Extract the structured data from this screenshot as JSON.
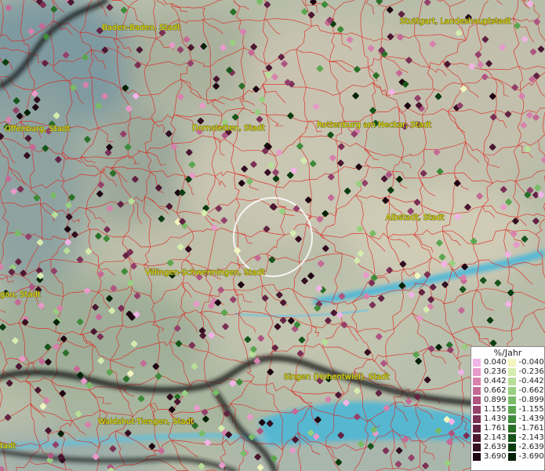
{
  "cities": [
    {
      "name": "Baden-Baden, Stadt"
    },
    {
      "name": "Stuttgart, Landeshauptstadt"
    },
    {
      "name": "Offenburg, Stadt"
    },
    {
      "name": "Dornstetten, Stadt"
    },
    {
      "name": "Rottenburg am Neckar, Stadt"
    },
    {
      "name": "Albstadt, Stadt"
    },
    {
      "name": "Villingen-Schwenningen, Stadt"
    },
    {
      "name": "Singen (Hohentwiel), Stadt"
    },
    {
      "name": "Waldshut-Tiengen, Stadt"
    },
    {
      "name": "gau, Stadt"
    },
    {
      "name": "tadt"
    }
  ],
  "legend": {
    "title": "%/Jahr",
    "positive": [
      {
        "label": "0.040",
        "color": "#f2b3e6"
      },
      {
        "label": "0.236",
        "color": "#e79ac9"
      },
      {
        "label": "0.442",
        "color": "#d781ad"
      },
      {
        "label": "0.662",
        "color": "#c46a95"
      },
      {
        "label": "0.899",
        "color": "#ae5580"
      },
      {
        "label": "1.155",
        "color": "#94416b"
      },
      {
        "label": "1.439",
        "color": "#7b3055"
      },
      {
        "label": "1.761",
        "color": "#632343"
      },
      {
        "label": "2.143",
        "color": "#4b1731"
      },
      {
        "label": "2.639",
        "color": "#340e21"
      },
      {
        "label": "3.690",
        "color": "#1e0512"
      }
    ],
    "negative": [
      {
        "label": "-0.040",
        "color": "#f2f5bd"
      },
      {
        "label": "-0.236",
        "color": "#d5ecae"
      },
      {
        "label": "-0.442",
        "color": "#b8df98"
      },
      {
        "label": "-0.662",
        "color": "#98cf80"
      },
      {
        "label": "-0.899",
        "color": "#79bb66"
      },
      {
        "label": "-1.155",
        "color": "#5ba54e"
      },
      {
        "label": "-1.439",
        "color": "#3e8b3a"
      },
      {
        "label": "-1.761",
        "color": "#2a7029"
      },
      {
        "label": "-2.143",
        "color": "#17551b"
      },
      {
        "label": "-2.639",
        "color": "#0b3c10"
      },
      {
        "label": "-3.690",
        "color": "#032206"
      }
    ]
  },
  "colors": {
    "boundary": "#e0201a",
    "water": "#4fb8d8",
    "border": "#151515",
    "label": "#e8e400"
  }
}
